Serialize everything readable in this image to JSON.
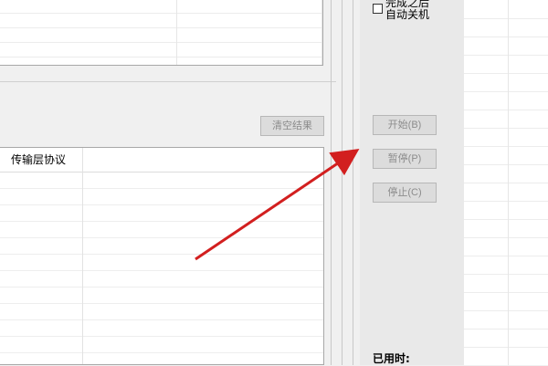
{
  "auto_shutdown": {
    "label_line1": "完成之后",
    "label_line2": "自动关机",
    "checked": false
  },
  "results": {
    "clear_label": "清空结果"
  },
  "controls": {
    "start_label": "开始(B)",
    "pause_label": "暂停(P)",
    "stop_label": "停止(C)"
  },
  "table": {
    "columns": [
      "传输层协议"
    ]
  },
  "status": {
    "elapsed_label": "已用时:"
  },
  "colors": {
    "annotation_arrow": "#d21f1f"
  },
  "icons": {
    "auto_shutdown_box": "checkbox-icon"
  }
}
